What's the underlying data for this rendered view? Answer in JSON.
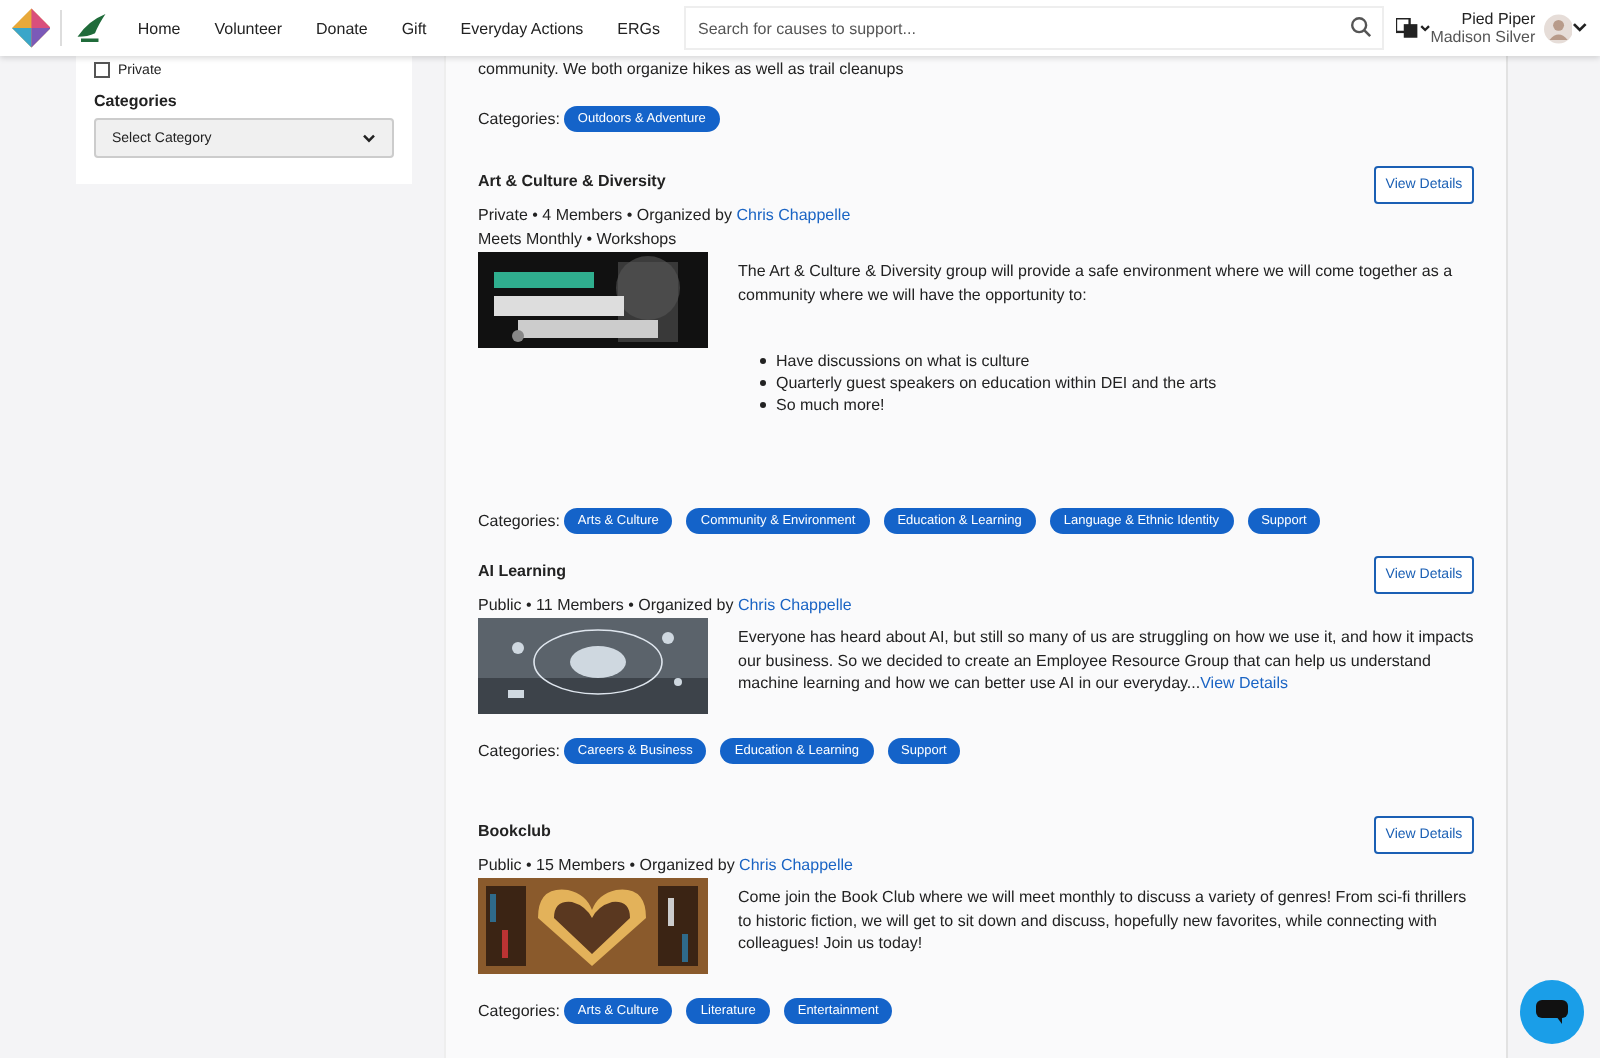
{
  "nav": {
    "links": [
      "Home",
      "Volunteer",
      "Donate",
      "Gift",
      "Everyday Actions",
      "ERGs"
    ],
    "search": {
      "placeholder": "Search for causes to support..."
    },
    "user": {
      "org": "Pied Piper",
      "name": "Madison Silver"
    }
  },
  "sidebar": {
    "private": {
      "label": "Private",
      "checked": false
    },
    "categories_label": "Categories",
    "select": {
      "placeholder": "Select Category"
    }
  },
  "partial_group": {
    "description": "community. We both organize hikes as well as trail cleanups",
    "categories_label": "Categories:",
    "categories": [
      "Outdoors & Adventure"
    ]
  },
  "groups": [
    {
      "title": "Art & Culture & Diversity",
      "meta": "Private • 4 Members • Organized by",
      "organizer": "Chris Chappelle",
      "schedule": "Meets Monthly • Workshops",
      "button": "View Details",
      "description": "The Art & Culture & Diversity group will provide a safe environment where we will come together as a community where we will have the opportunity to:",
      "bullets": [
        "Have discussions on what is culture",
        "Quarterly guest speakers on education within DEI and the arts",
        "So much more!"
      ],
      "kind": "picture",
      "categories_label": "Categories:",
      "categories": [
        "Arts & Culture",
        "Community & Environment",
        "Education & Learning",
        "Language & Ethnic Identity",
        "Support"
      ]
    },
    {
      "title": "AI Learning",
      "meta": "Public • 11 Members • Organized by",
      "organizer": "Chris Chappelle",
      "button": "View Details",
      "description": "Everyone has heard about AI, but still so many of us are struggling on how we use it, and how it impacts our business. So we decided to create an Employee Resource Group that can help us understand machine learning and how we can better use AI in our everyday...",
      "more_link": "View Details",
      "kind": "picture",
      "categories_label": "Categories:",
      "categories": [
        "Careers & Business",
        "Education & Learning",
        "Support"
      ]
    },
    {
      "title": "Bookclub",
      "meta": "Public • 15 Members • Organized by",
      "organizer": "Chris Chappelle",
      "button": "View Details",
      "description": "Come join the Book Club where we will meet monthly to discuss a variety of genres! From sci-fi thrillers to historic fiction, we will get to sit down and discuss, hopefully new favorites, while connecting with colleagues! Join us today!",
      "kind": "picture",
      "categories_label": "Categories:",
      "categories": [
        "Arts & Culture",
        "Literature",
        "Entertainment"
      ]
    }
  ]
}
